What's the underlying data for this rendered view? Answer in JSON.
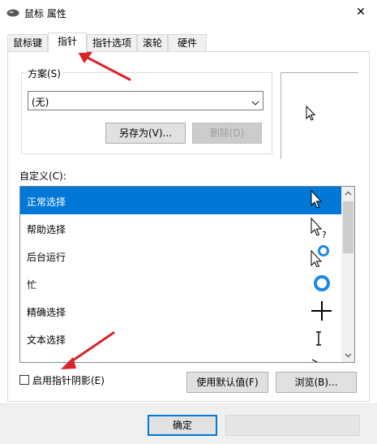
{
  "window": {
    "title": "鼠标 属性",
    "close_glyph": "✕"
  },
  "tabs": [
    {
      "label": "鼠标键",
      "active": false
    },
    {
      "label": "指针",
      "active": true
    },
    {
      "label": "指针选项",
      "active": false
    },
    {
      "label": "滚轮",
      "active": false
    },
    {
      "label": "硬件",
      "active": false
    }
  ],
  "scheme": {
    "label": "方案(S)",
    "selected": "(无)",
    "save_as_label": "另存为(V)...",
    "delete_label": "删除(D)"
  },
  "customize": {
    "label": "自定义(C):",
    "items": [
      {
        "label": "正常选择",
        "icon": "arrow-cursor-icon",
        "selected": true
      },
      {
        "label": "帮助选择",
        "icon": "help-cursor-icon",
        "selected": false
      },
      {
        "label": "后台运行",
        "icon": "working-in-background-cursor-icon",
        "selected": false
      },
      {
        "label": "忙",
        "icon": "busy-cursor-icon",
        "selected": false
      },
      {
        "label": "精确选择",
        "icon": "crosshair-cursor-icon",
        "selected": false
      },
      {
        "label": "文本选择",
        "icon": "text-select-cursor-icon",
        "selected": false
      },
      {
        "label": "",
        "icon": "handwriting-cursor-icon",
        "selected": false
      }
    ]
  },
  "shadow": {
    "label": "启用指针阴影(E)",
    "checked": false
  },
  "buttons": {
    "use_default": "使用默认值(F)",
    "browse": "浏览(B)...",
    "ok": "确定"
  },
  "colors": {
    "selection": "#0078d7",
    "annotation_arrow": "#d9232a",
    "busy_ring": "#1e88e5"
  }
}
